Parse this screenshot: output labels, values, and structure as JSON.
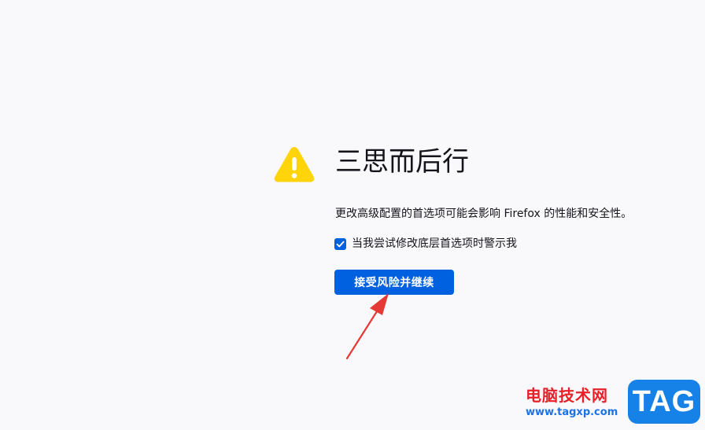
{
  "page": {
    "title": "三思而后行",
    "warning_text": "更改高级配置的首选项可能会影响 Firefox 的性能和安全性。",
    "checkbox": {
      "label": "当我尝试修改底层首选项时警示我",
      "checked": true
    },
    "accept_button_label": "接受风险并继续"
  },
  "icons": {
    "warning": "warning-triangle-icon",
    "checkmark": "checkmark-icon"
  },
  "annotation": {
    "type": "arrow",
    "color": "#e53935"
  },
  "watermark": {
    "site_name": "电脑技术网",
    "url": "www.tagxp.com",
    "logo_text": "TAG"
  },
  "colors": {
    "background": "#f9f9fb",
    "accent": "#0061e0",
    "warning": "#ffd40b",
    "text": "#15141a"
  }
}
